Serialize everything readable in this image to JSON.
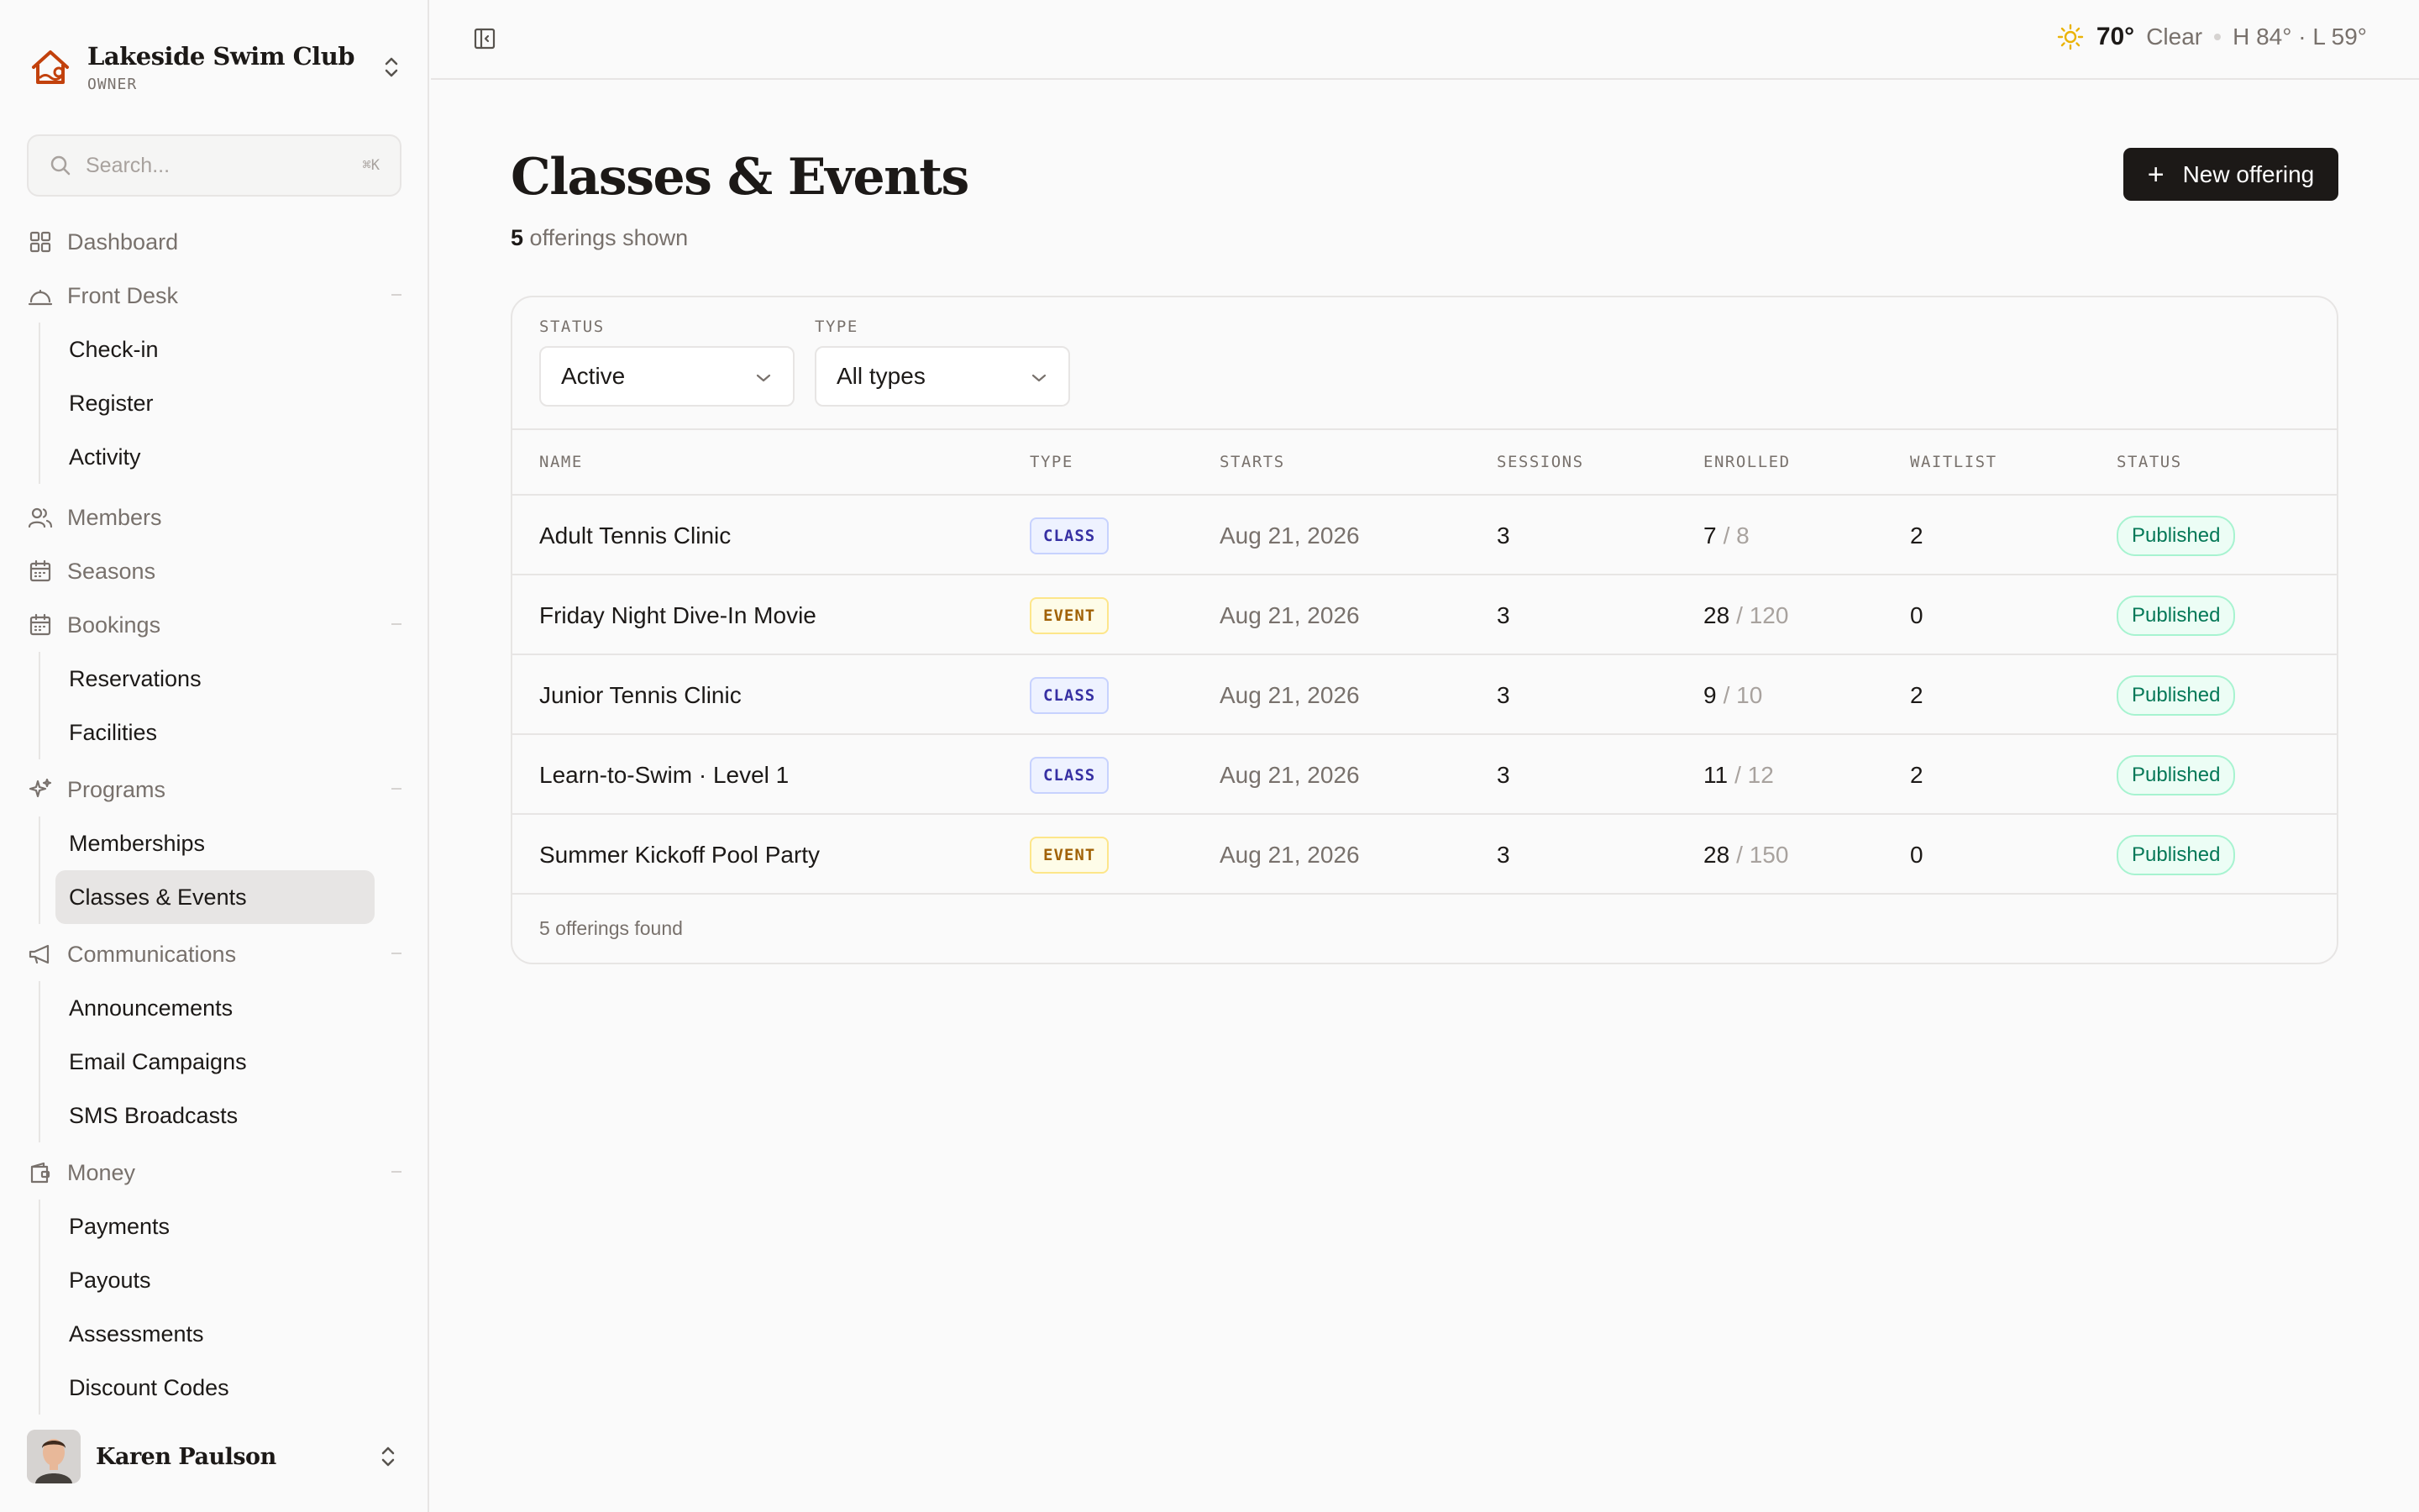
{
  "brand": {
    "name": "Lakeside Swim Club",
    "role": "OWNER"
  },
  "search": {
    "placeholder": "Search...",
    "shortcut": "⌘K"
  },
  "nav": {
    "dashboard": "Dashboard",
    "front_desk": {
      "label": "Front Desk",
      "items": [
        "Check-in",
        "Register",
        "Activity"
      ]
    },
    "members": "Members",
    "seasons": "Seasons",
    "bookings": {
      "label": "Bookings",
      "items": [
        "Reservations",
        "Facilities"
      ]
    },
    "programs": {
      "label": "Programs",
      "items": [
        "Memberships",
        "Classes & Events"
      ]
    },
    "communications": {
      "label": "Communications",
      "items": [
        "Announcements",
        "Email Campaigns",
        "SMS Broadcasts"
      ]
    },
    "money": {
      "label": "Money",
      "items": [
        "Payments",
        "Payouts",
        "Assessments",
        "Discount Codes"
      ]
    }
  },
  "user": {
    "name": "Karen Paulson"
  },
  "weather": {
    "temp": "70°",
    "condition": "Clear",
    "high_low": "H 84° · L 59°"
  },
  "page": {
    "title": "Classes & Events",
    "count": "5",
    "subtitle_suffix": "offerings shown",
    "new_button": "New offering"
  },
  "filters": {
    "status": {
      "label": "STATUS",
      "value": "Active"
    },
    "type": {
      "label": "TYPE",
      "value": "All types"
    }
  },
  "table": {
    "headers": [
      "NAME",
      "TYPE",
      "STARTS",
      "SESSIONS",
      "ENROLLED",
      "WAITLIST",
      "STATUS"
    ],
    "rows": [
      {
        "name": "Adult Tennis Clinic",
        "type": "CLASS",
        "starts": "Aug 21, 2026",
        "sessions": "3",
        "enrolled": "7",
        "capacity": "/ 8",
        "waitlist": "2",
        "status": "Published"
      },
      {
        "name": "Friday Night Dive-In Movie",
        "type": "EVENT",
        "starts": "Aug 21, 2026",
        "sessions": "3",
        "enrolled": "28",
        "capacity": "/ 120",
        "waitlist": "0",
        "status": "Published"
      },
      {
        "name": "Junior Tennis Clinic",
        "type": "CLASS",
        "starts": "Aug 21, 2026",
        "sessions": "3",
        "enrolled": "9",
        "capacity": "/ 10",
        "waitlist": "2",
        "status": "Published"
      },
      {
        "name": "Learn-to-Swim · Level 1",
        "type": "CLASS",
        "starts": "Aug 21, 2026",
        "sessions": "3",
        "enrolled": "11",
        "capacity": "/ 12",
        "waitlist": "2",
        "status": "Published"
      },
      {
        "name": "Summer Kickoff Pool Party",
        "type": "EVENT",
        "starts": "Aug 21, 2026",
        "sessions": "3",
        "enrolled": "28",
        "capacity": "/ 150",
        "waitlist": "0",
        "status": "Published"
      }
    ],
    "footer": "5 offerings found"
  },
  "colors": {
    "brand_orange": "#c2410c",
    "published_green": "#047857",
    "sun_yellow": "#eab308"
  }
}
